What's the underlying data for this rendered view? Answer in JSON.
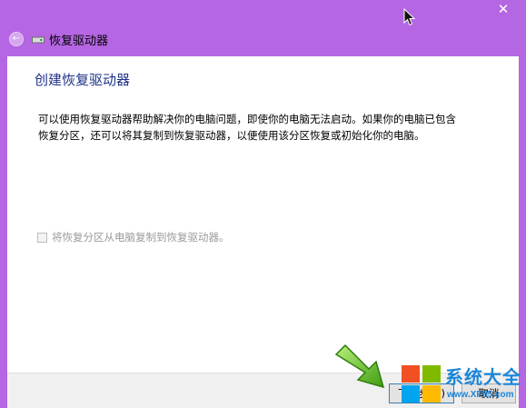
{
  "window": {
    "title": "恢复驱动器",
    "close_symbol": "✕",
    "back_symbol": "←",
    "accent_color": "#b566e3"
  },
  "page": {
    "heading": "创建恢复驱动器",
    "description": "可以使用恢复驱动器帮助解决你的电脑问题，即使你的电脑无法启动。如果你的电脑已包含恢复分区，还可以将其复制到恢复驱动器，以便使用该分区恢复或初始化你的电脑。",
    "checkbox_label": "将恢复分区从电脑复制到恢复驱动器。",
    "checkbox_checked": false,
    "checkbox_enabled": false
  },
  "footer": {
    "next_label": "下一步(N)",
    "cancel_label": "取消"
  },
  "watermark": {
    "brand": "系统大全",
    "url": "www.XP85.com"
  },
  "icons": [
    "back-arrow-icon",
    "drive-icon",
    "close-icon",
    "mouse-cursor-icon",
    "green-arrow-icon",
    "windows-logo-icon"
  ]
}
